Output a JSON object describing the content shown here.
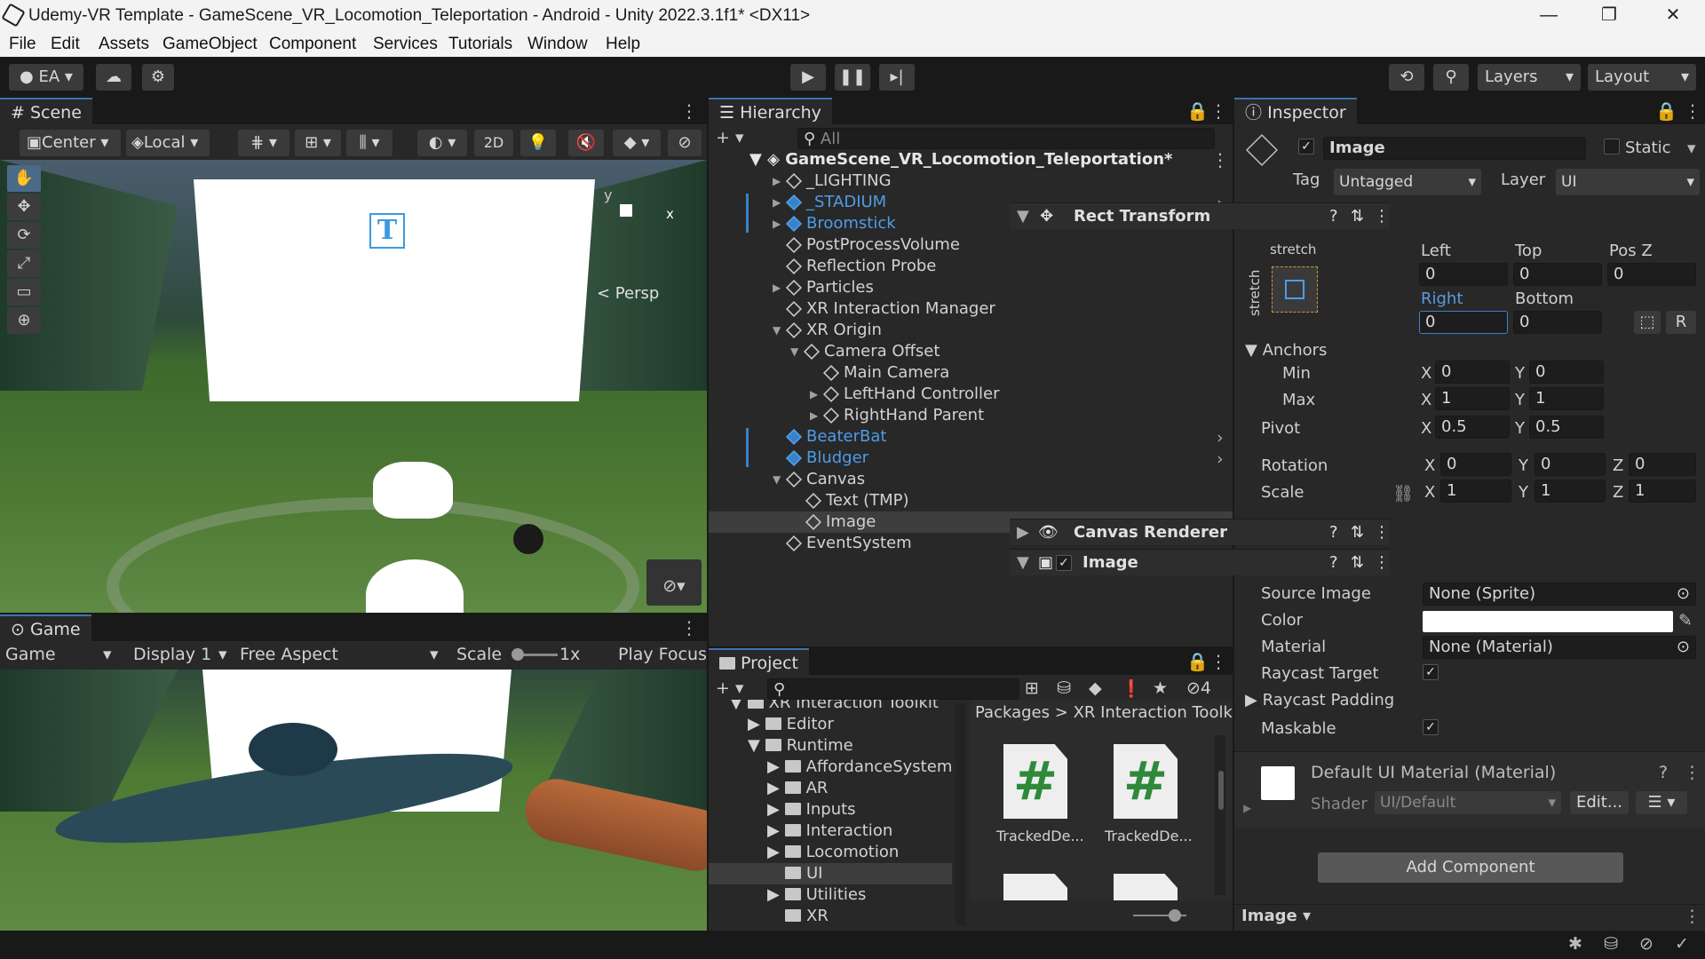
{
  "window": {
    "title": "Udemy-VR Template - GameScene_VR_Locomotion_Teleportation - Android - Unity 2022.3.1f1* <DX11>",
    "min": "—",
    "max": "❐",
    "close": "✕"
  },
  "menu": [
    "File",
    "Edit",
    "Assets",
    "GameObject",
    "Component",
    "Services",
    "Tutorials",
    "Window",
    "Help"
  ],
  "toolbar": {
    "account": "EA",
    "layers": "Layers",
    "layout": "Layout"
  },
  "scene": {
    "tab": "Scene",
    "pivot": "Center",
    "space": "Local",
    "mode2d": "2D",
    "persp": "< Persp",
    "gizmo_y": "y",
    "gizmo_x": "x",
    "canvas_text": "T"
  },
  "game": {
    "tab": "Game",
    "view": "Game",
    "display": "Display 1",
    "aspect": "Free Aspect",
    "scale_label": "Scale",
    "scale_value": "1x",
    "play_focus": "Play Focus"
  },
  "hierarchy": {
    "tab": "Hierarchy",
    "search_placeholder": "All",
    "scene_name": "GameScene_VR_Locomotion_Teleportation*",
    "items": [
      {
        "label": "_LIGHTING"
      },
      {
        "label": "_STADIUM"
      },
      {
        "label": "Broomstick"
      },
      {
        "label": "PostProcessVolume"
      },
      {
        "label": "Reflection Probe"
      },
      {
        "label": "Particles"
      },
      {
        "label": "XR Interaction Manager"
      },
      {
        "label": "XR Origin"
      },
      {
        "label": "Camera Offset"
      },
      {
        "label": "Main Camera"
      },
      {
        "label": "LeftHand Controller"
      },
      {
        "label": "RightHand Parent"
      },
      {
        "label": "BeaterBat"
      },
      {
        "label": "Bludger"
      },
      {
        "label": "Canvas"
      },
      {
        "label": "Text (TMP)"
      },
      {
        "label": "Image"
      },
      {
        "label": "EventSystem"
      }
    ]
  },
  "project": {
    "tab": "Project",
    "hidden_count": "4",
    "tree": [
      "XR Interaction Toolkit",
      "Editor",
      "Runtime",
      "AffordanceSystem",
      "AR",
      "Inputs",
      "Interaction",
      "Locomotion",
      "UI",
      "Utilities",
      "XR"
    ],
    "breadcrumb": [
      "Packages",
      ">",
      "XR Interaction Toolk"
    ],
    "assets": [
      "TrackedDe...",
      "TrackedDe..."
    ],
    "asset_glyph": "#"
  },
  "inspector": {
    "tab": "Inspector",
    "object_name": "Image",
    "static_label": "Static",
    "tag_label": "Tag",
    "tag_value": "Untagged",
    "layer_label": "Layer",
    "layer_value": "UI",
    "rect": {
      "title": "Rect Transform",
      "stretch_h": "stretch",
      "stretch_v": "stretch",
      "left_label": "Left",
      "top_label": "Top",
      "posz_label": "Pos Z",
      "left": "0",
      "top": "0",
      "posz": "0",
      "right_label": "Right",
      "bottom_label": "Bottom",
      "right": "0",
      "bottom": "0",
      "raw_btn": "R",
      "anchors": "Anchors",
      "min": "Min",
      "max": "Max",
      "pivot": "Pivot",
      "min_x": "0",
      "min_y": "0",
      "max_x": "1",
      "max_y": "1",
      "pivot_x": "0.5",
      "pivot_y": "0.5",
      "rotation": "Rotation",
      "scale": "Scale",
      "rot_x": "0",
      "rot_y": "0",
      "rot_z": "0",
      "scale_x": "1",
      "scale_y": "1",
      "scale_z": "1",
      "x": "X",
      "y": "Y",
      "z": "Z"
    },
    "canvas_renderer": "Canvas Renderer",
    "image": {
      "title": "Image",
      "source_label": "Source Image",
      "source": "None (Sprite)",
      "color_label": "Color",
      "material_label": "Material",
      "material": "None (Material)",
      "raycast_target": "Raycast Target",
      "raycast_padding": "Raycast Padding",
      "maskable": "Maskable",
      "check": "✓"
    },
    "material": {
      "title": "Default UI Material (Material)",
      "shader_label": "Shader",
      "shader": "UI/Default",
      "edit": "Edit..."
    },
    "add_component": "Add Component",
    "footer": "Image"
  }
}
